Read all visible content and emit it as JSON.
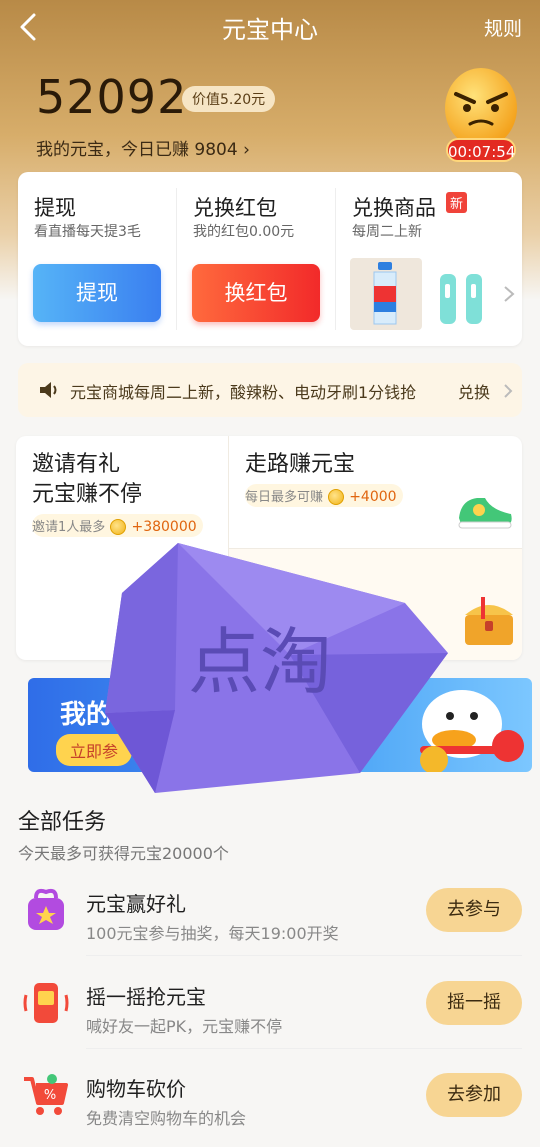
{
  "header": {
    "title": "元宝中心",
    "rules_label": "规则",
    "balance": "52092",
    "value_label": "价值5.20元",
    "earned_text": "我的元宝，今日已赚 9804",
    "timer": "00:07:54"
  },
  "actions": [
    {
      "title": "提现",
      "subtitle": "看直播每天提3毛",
      "button": "提现"
    },
    {
      "title": "兑换红包",
      "subtitle": "我的红包0.00元",
      "button": "换红包"
    },
    {
      "title": "兑换商品",
      "subtitle": "每周二上新",
      "badge": "新"
    }
  ],
  "notice": {
    "text": "元宝商城每周二上新，酸辣粉、电动牙刷1分钱抢",
    "action": "兑换"
  },
  "promos": {
    "invite": {
      "title_line1": "邀请有礼",
      "title_line2": "元宝赚不停",
      "note": "邀请1人最多",
      "reward": "+380000"
    },
    "walk": {
      "title": "走路赚元宝",
      "note": "每日最多可赚",
      "reward": "+4000"
    }
  },
  "banner": {
    "text": "我的",
    "cta": "立即参"
  },
  "watermark": {
    "text": "点淘"
  },
  "tasks_section": {
    "title": "全部任务",
    "subtitle": "今天最多可获得元宝20000个"
  },
  "tasks": [
    {
      "name": "元宝赢好礼",
      "desc": "100元宝参与抽奖，每天19:00开奖",
      "button": "去参与"
    },
    {
      "name": "摇一摇抢元宝",
      "desc": "喊好友一起PK，元宝赚不停",
      "button": "摇一摇"
    },
    {
      "name": "购物车砍价",
      "desc": "免费清空购物车的机会",
      "button": "去参加"
    }
  ]
}
